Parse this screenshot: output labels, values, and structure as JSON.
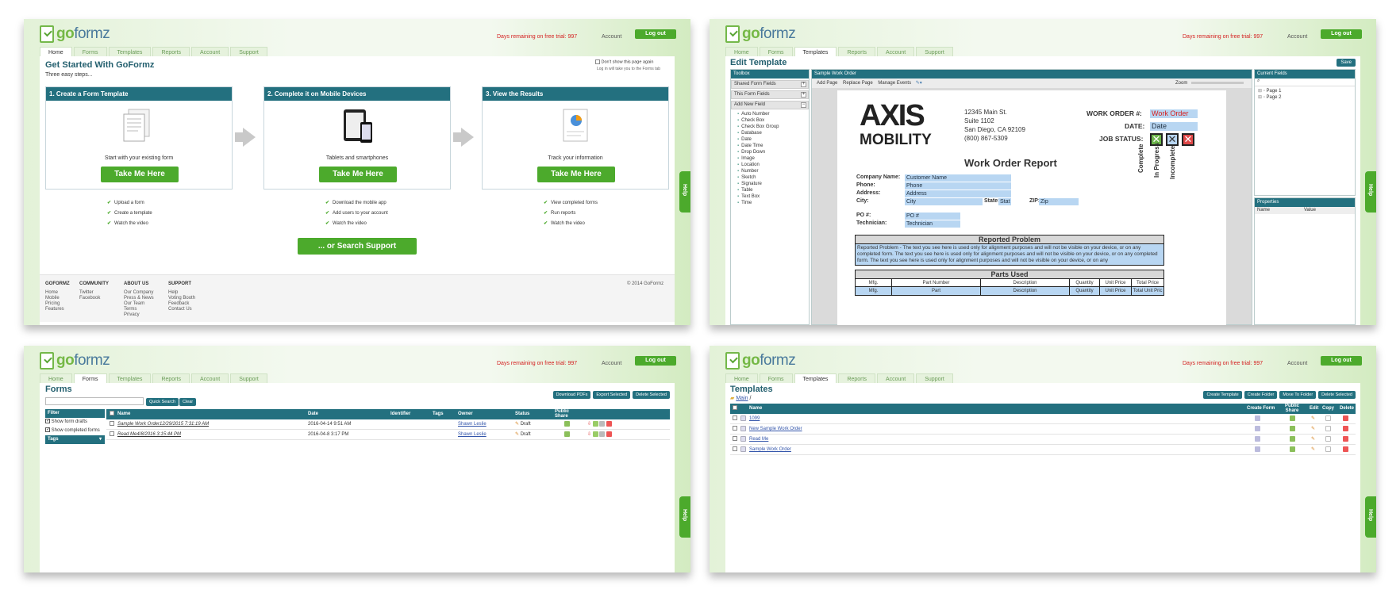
{
  "brand": {
    "logo_go": "go",
    "logo_formz": "formz"
  },
  "header": {
    "trial": "Days remaining on free trial: 997",
    "account": "Account",
    "logout": "Log out"
  },
  "tabs": [
    "Home",
    "Forms",
    "Templates",
    "Reports",
    "Account",
    "Support"
  ],
  "help_label": "Help",
  "colors": {
    "accent": "#23707f",
    "green": "#4caa2c",
    "trial_red": "#d42020",
    "field_blue": "#b8d6f2"
  },
  "home": {
    "title": "Get Started With GoFormz",
    "subtitle": "Three easy steps...",
    "dont_show": "Don't show this page again",
    "dont_show_note": "Log in will take you to the Forms tab",
    "steps": [
      {
        "title": "1. Create a Form Template",
        "caption": "Start with your existing form",
        "button": "Take Me Here",
        "bullets": [
          "Upload a form",
          "Create a template",
          "Watch the video"
        ]
      },
      {
        "title": "2. Complete it on Mobile Devices",
        "caption": "Tablets and smartphones",
        "button": "Take Me Here",
        "bullets": [
          "Download the mobile app",
          "Add users to your account",
          "Watch the video"
        ]
      },
      {
        "title": "3. View the Results",
        "caption": "Track your information",
        "button": "Take Me Here",
        "bullets": [
          "View completed forms",
          "Run reports",
          "Watch the video"
        ]
      }
    ],
    "search_support": "... or Search Support",
    "footer": {
      "cols": [
        {
          "title": "GOFORMZ",
          "links": [
            "Home",
            "Mobile",
            "Pricing",
            "Features"
          ]
        },
        {
          "title": "COMMUNITY",
          "links": [
            "Twitter",
            "Facebook"
          ]
        },
        {
          "title": "ABOUT US",
          "links": [
            "Our Company",
            "Press & News",
            "Our Team",
            "Terms",
            "Privacy"
          ]
        },
        {
          "title": "SUPPORT",
          "links": [
            "Help",
            "Voting Booth",
            "Feedback",
            "Contact Us"
          ]
        }
      ],
      "copyright": "© 2014 GoFormz"
    }
  },
  "edit": {
    "title": "Edit Template",
    "save": "Save",
    "toolbox": "Toolbox",
    "shared_fields": "Shared Form Fields",
    "this_fields": "This Form Fields",
    "add_new": "Add New Field",
    "field_types": [
      "Auto Number",
      "Check Box",
      "Check Box Group",
      "Database",
      "Date",
      "Date Time",
      "Drop Down",
      "Image",
      "Location",
      "Number",
      "Sketch",
      "Signature",
      "Table",
      "Text Box",
      "Time"
    ],
    "doc_tab": "Sample Work Order",
    "doc_tools": [
      "Add Page",
      "Replace Page",
      "Manage Events"
    ],
    "zoom": "Zoom",
    "current_fields": "Current Fields",
    "pages": [
      "Page 1",
      "Page 2"
    ],
    "properties": "Properties",
    "prop_cols": [
      "Name",
      "Value"
    ],
    "doc": {
      "brand_top": "AXIS",
      "brand_bottom": "MOBILITY",
      "address": [
        "12345 Main St.",
        "Suite 1102",
        "San Diego, CA 92109",
        "(800) 867-5309"
      ],
      "wo_label": "WORK ORDER #:",
      "wo_value": "Work Order",
      "date_label": "DATE:",
      "date_value": "Date",
      "status_label": "JOB STATUS:",
      "status_opts": [
        "Complete",
        "In Progress",
        "Incomplete"
      ],
      "report_title": "Work Order Report",
      "labels": {
        "company": "Company Name:",
        "phone": "Phone:",
        "address": "Address:",
        "city": "City:",
        "state": "State:",
        "zip": "ZIP:",
        "po": "PO #:",
        "tech": "Technician:"
      },
      "values": {
        "company": "Customer Name",
        "phone": "Phone",
        "address": "Address",
        "city": "City",
        "state": "Stat",
        "zip": "Zip",
        "po": "PO #",
        "tech": "Technician"
      },
      "reported_title": "Reported Problem",
      "reported_text": "Reported Problem - The text you see here is used only for alignment purposes and will not be visible on your device, or on any completed form. The text you see here is used only for alignment purposes and will not be visible on your device, or on any completed form. The text you see here is used only for alignment purposes and will not be visible on your device, or on any",
      "parts_title": "Parts Used",
      "parts_cols": [
        "Mfg.",
        "Part Number",
        "Description",
        "Quantity",
        "Unit Price",
        "Total Price"
      ],
      "parts_row": [
        "Mfg.",
        "Part",
        "Description",
        "Quantity",
        "Unit Price",
        "Total Unit Pric"
      ]
    }
  },
  "forms": {
    "title": "Forms",
    "search_placeholder": "",
    "quick_search": "Quick Search",
    "clear": "Clear",
    "actions": [
      "Download PDFs",
      "Export Selected",
      "Delete Selected"
    ],
    "filter": "Filter",
    "filter_opts": [
      "Show form drafts",
      "Show completed forms"
    ],
    "tags": "Tags",
    "cols": [
      "Name",
      "Date",
      "Identifier",
      "Tags",
      "Owner",
      "Status",
      "Public Share"
    ],
    "rows": [
      {
        "name": "Sample Work Order12/29/2015 7:31:19 AM",
        "date": "2016-04-14 9:51 AM",
        "owner": "Shawn Leslie",
        "status": "Draft"
      },
      {
        "name": "Read Me4/8/2016 3:15:44 PM",
        "date": "2016-04-8 3:17 PM",
        "owner": "Shawn Leslie",
        "status": "Draft"
      }
    ]
  },
  "templates": {
    "title": "Templates",
    "breadcrumb": "Main",
    "breadcrumb_sep": "/",
    "actions": [
      "Create Template",
      "Create Folder",
      "Move To Folder",
      "Delete Selected"
    ],
    "cols": [
      "Name",
      "Create Form",
      "Public Share",
      "Edit",
      "Copy",
      "Delete"
    ],
    "rows": [
      "1099",
      "New Sample Work Order",
      "Read Me",
      "Sample Work Order"
    ]
  }
}
